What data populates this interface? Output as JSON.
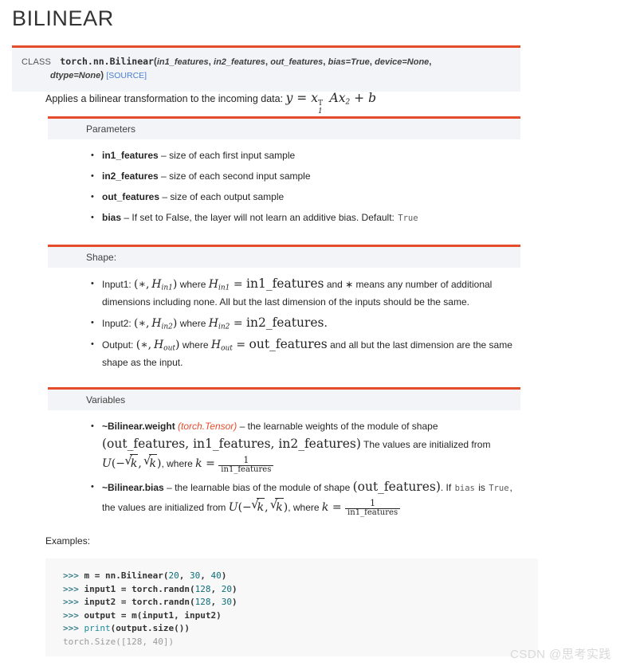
{
  "page": {
    "title": "BILINEAR",
    "accent_color": "#e44c2c",
    "header_bg": "#f3f4f7",
    "code_bg": "#f8f8f8",
    "link_color": "#4a7fd6"
  },
  "signature": {
    "keyword": "CLASS",
    "qualname": "torch.nn.Bilinear",
    "open_paren": "(",
    "args": [
      "in1_features",
      "in2_features",
      "out_features",
      "bias=True",
      "device=None",
      "dtype=None"
    ],
    "close_paren": ")",
    "source_label": "[SOURCE]"
  },
  "description": {
    "text": "Applies a bilinear transformation to the incoming data:",
    "formula": {
      "y": "y",
      "eq": "=",
      "x1": "x",
      "x1_sup": "T",
      "x1_sub": "1",
      "A": "A",
      "x2": "x",
      "x2_sub": "2",
      "plus": "+",
      "b": "b"
    }
  },
  "sections": [
    {
      "id": "parameters",
      "header": "Parameters",
      "items": [
        {
          "name": "in1_features",
          "dash": "–",
          "desc": "size of each first input sample"
        },
        {
          "name": "in2_features",
          "dash": "–",
          "desc": "size of each second input sample"
        },
        {
          "name": "out_features",
          "dash": "–",
          "desc": "size of each output sample"
        },
        {
          "name": "bias",
          "dash": "–",
          "desc": "If set to False, the layer will not learn an additive bias. Default:",
          "code_suffix": "True"
        }
      ]
    },
    {
      "id": "shape",
      "header": "Shape:",
      "items": [
        {
          "label": "Input1:",
          "shape_h": "H",
          "shape_sub": "in1",
          "where": "where",
          "eq_var": "in1_features",
          "tail": "and ∗ means any number of additional dimensions including none. All but the last dimension of the inputs should be the same."
        },
        {
          "label": "Input2:",
          "shape_h": "H",
          "shape_sub": "in2",
          "where": "where",
          "eq_var": "in2_features",
          "tail": "."
        },
        {
          "label": "Output:",
          "shape_h": "H",
          "shape_sub": "out",
          "where": "where",
          "eq_var": "out_features",
          "tail": "and all but the last dimension are the same shape as the input."
        }
      ]
    },
    {
      "id": "variables",
      "header": "Variables",
      "items": [
        {
          "name": "~Bilinear.weight",
          "type": "(torch.Tensor)",
          "dash": "–",
          "desc_1": "the learnable weights of the module of shape",
          "tuple": "(out_features, in1_features, in2_features)",
          "desc_2": "The values are initialized from",
          "dist": "U",
          "desc_3": ", where",
          "k_label": "k",
          "k_num": "1",
          "k_den": "in1_features"
        },
        {
          "name": "~Bilinear.bias",
          "type": "",
          "dash": "–",
          "desc_1": "the learnable bias of the module of shape",
          "tuple": "(out_features)",
          "desc_2": ". If",
          "code_bias": "bias",
          "desc_is": "is",
          "code_true": "True",
          "desc_3": ", the values are initialized from",
          "dist": "U",
          "desc_4": ", where",
          "k_label": "k",
          "k_num": "1",
          "k_den": "in1_features"
        }
      ]
    }
  ],
  "examples": {
    "label": "Examples:",
    "lines": [
      [
        {
          "t": ">>> ",
          "c": "cp"
        },
        {
          "t": "m = nn.Bilinear",
          "c": "cd"
        },
        {
          "t": "(",
          "c": "cd"
        },
        {
          "t": "20",
          "c": "cn"
        },
        {
          "t": ", ",
          "c": "cd"
        },
        {
          "t": "30",
          "c": "cn"
        },
        {
          "t": ", ",
          "c": "cd"
        },
        {
          "t": "40",
          "c": "cn"
        },
        {
          "t": ")",
          "c": "cd"
        }
      ],
      [
        {
          "t": ">>> ",
          "c": "cp"
        },
        {
          "t": "input1 = torch.randn",
          "c": "cd"
        },
        {
          "t": "(",
          "c": "cd"
        },
        {
          "t": "128",
          "c": "cn"
        },
        {
          "t": ", ",
          "c": "cd"
        },
        {
          "t": "20",
          "c": "cn"
        },
        {
          "t": ")",
          "c": "cd"
        }
      ],
      [
        {
          "t": ">>> ",
          "c": "cp"
        },
        {
          "t": "input2 = torch.randn",
          "c": "cd"
        },
        {
          "t": "(",
          "c": "cd"
        },
        {
          "t": "128",
          "c": "cn"
        },
        {
          "t": ", ",
          "c": "cd"
        },
        {
          "t": "30",
          "c": "cn"
        },
        {
          "t": ")",
          "c": "cd"
        }
      ],
      [
        {
          "t": ">>> ",
          "c": "cp"
        },
        {
          "t": "output = m(input1, input2)",
          "c": "cd"
        }
      ],
      [
        {
          "t": ">>> ",
          "c": "cp"
        },
        {
          "t": "print",
          "c": "cf"
        },
        {
          "t": "(output.size())",
          "c": "cd"
        }
      ],
      [
        {
          "t": "torch.Size([128, 40])",
          "c": "co"
        }
      ]
    ]
  },
  "watermark": "CSDN @思考实践"
}
